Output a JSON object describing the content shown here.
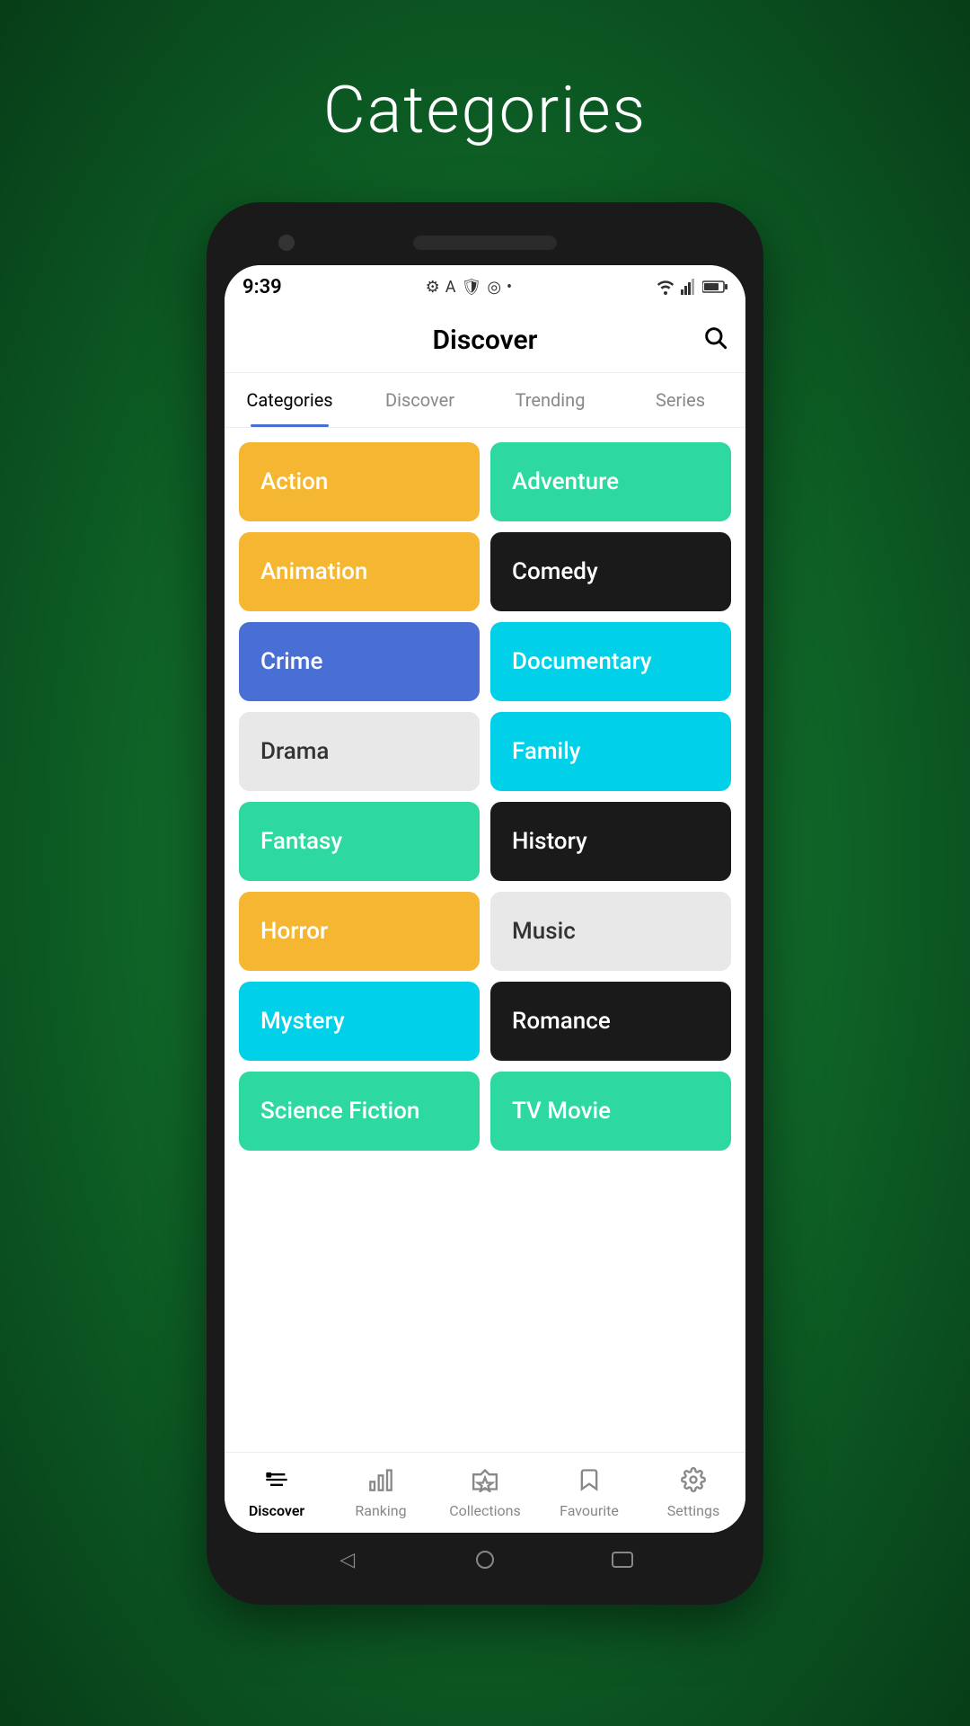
{
  "page": {
    "background_title": "Categories",
    "app_title": "Discover",
    "status": {
      "time": "9:39",
      "icons": [
        "⚙",
        "A",
        "🛡",
        "◎",
        "•"
      ],
      "right_icons": [
        "wifi",
        "signal",
        "battery"
      ]
    },
    "tabs": [
      {
        "label": "Categories",
        "active": true
      },
      {
        "label": "Discover",
        "active": false
      },
      {
        "label": "Trending",
        "active": false
      },
      {
        "label": "Series",
        "active": false
      }
    ],
    "categories": [
      {
        "label": "Action",
        "class": "cat-action",
        "dark_text": false
      },
      {
        "label": "Adventure",
        "class": "cat-adventure",
        "dark_text": false
      },
      {
        "label": "Animation",
        "class": "cat-animation",
        "dark_text": false
      },
      {
        "label": "Comedy",
        "class": "cat-comedy",
        "dark_text": false
      },
      {
        "label": "Crime",
        "class": "cat-crime",
        "dark_text": false
      },
      {
        "label": "Documentary",
        "class": "cat-documentary",
        "dark_text": false
      },
      {
        "label": "Drama",
        "class": "cat-drama",
        "dark_text": true
      },
      {
        "label": "Family",
        "class": "cat-family",
        "dark_text": false
      },
      {
        "label": "Fantasy",
        "class": "cat-fantasy",
        "dark_text": false
      },
      {
        "label": "History",
        "class": "cat-history",
        "dark_text": false
      },
      {
        "label": "Horror",
        "class": "cat-horror",
        "dark_text": false
      },
      {
        "label": "Music",
        "class": "cat-music",
        "dark_text": true
      },
      {
        "label": "Mystery",
        "class": "cat-mystery",
        "dark_text": false
      },
      {
        "label": "Romance",
        "class": "cat-romance",
        "dark_text": false
      },
      {
        "label": "Science Fiction",
        "class": "cat-sci-fi",
        "dark_text": false
      },
      {
        "label": "TV Movie",
        "class": "cat-tv-movie",
        "dark_text": false
      }
    ],
    "bottom_nav": [
      {
        "label": "Discover",
        "icon": "🎬",
        "active": true
      },
      {
        "label": "Ranking",
        "icon": "📊",
        "active": false
      },
      {
        "label": "Collections",
        "icon": "🎞",
        "active": false
      },
      {
        "label": "Favourite",
        "icon": "🔖",
        "active": false
      },
      {
        "label": "Settings",
        "icon": "⚙",
        "active": false
      }
    ]
  }
}
